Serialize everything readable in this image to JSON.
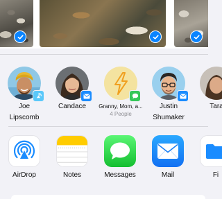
{
  "photos": [
    {
      "name": "photo-1",
      "selected": true
    },
    {
      "name": "photo-2",
      "selected": true
    },
    {
      "name": "photo-3",
      "selected": true
    }
  ],
  "people": [
    {
      "name_line1": "Joe",
      "name_line2": "Lipscomb",
      "badge": "airdrop-icon",
      "badge_color": "#5ac8fa"
    },
    {
      "name_line1": "Candace",
      "name_line2": "",
      "badge": "mail-icon",
      "badge_color": "#1a8cff"
    },
    {
      "name_line1": "Granny, Mom, a...",
      "name_line2": "4 People",
      "badge": "messages-icon",
      "badge_color": "#34c759"
    },
    {
      "name_line1": "Justin",
      "name_line2": "Shumaker",
      "badge": "mail-icon",
      "badge_color": "#1a8cff"
    },
    {
      "name_line1": "Tara",
      "name_line2": "",
      "badge": "",
      "badge_color": ""
    }
  ],
  "apps": [
    {
      "label": "AirDrop",
      "icon": "airdrop-icon"
    },
    {
      "label": "Notes",
      "icon": "notes-icon"
    },
    {
      "label": "Messages",
      "icon": "messages-icon"
    },
    {
      "label": "Mail",
      "icon": "mail-icon"
    },
    {
      "label": "Fi",
      "icon": "files-icon"
    }
  ],
  "colors": {
    "accent": "#0a84ff",
    "messages_green": "#34c759",
    "mail_blue": "#1a8cff",
    "notes_yellow": "#ffcc00",
    "background": "#f2f2f7"
  }
}
